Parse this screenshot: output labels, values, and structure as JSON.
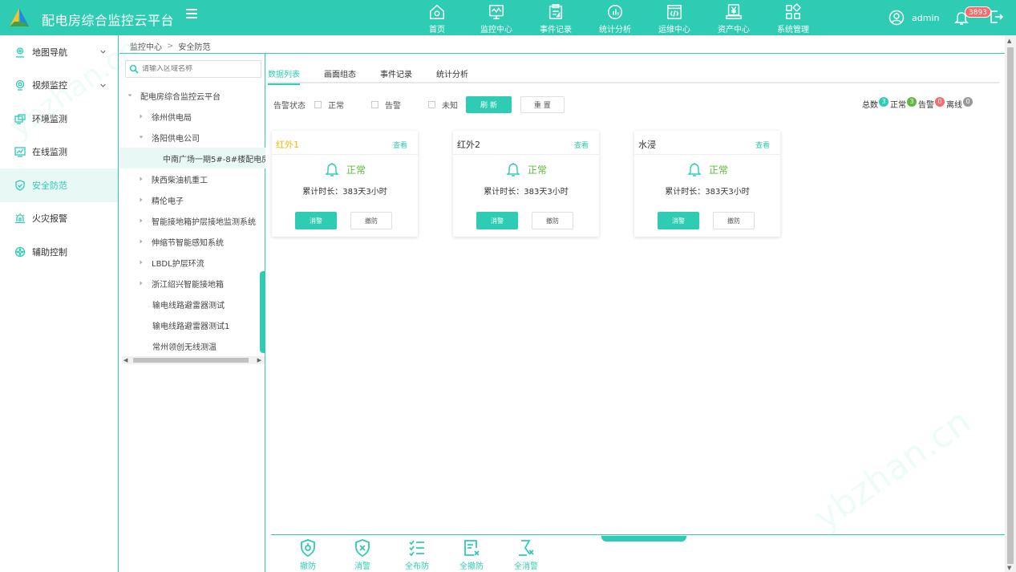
{
  "header": {
    "title": "配电房综合监控云平台",
    "nav": [
      {
        "label": "首页",
        "icon": "home-icon"
      },
      {
        "label": "监控中心",
        "icon": "monitor-icon"
      },
      {
        "label": "事件记录",
        "icon": "clipboard-icon"
      },
      {
        "label": "统计分析",
        "icon": "chart-icon"
      },
      {
        "label": "运维中心",
        "icon": "code-window-icon"
      },
      {
        "label": "资产中心",
        "icon": "asset-icon"
      },
      {
        "label": "系统管理",
        "icon": "grid-icon"
      }
    ],
    "user": "admin",
    "alarm_count": "3893"
  },
  "sidebar": {
    "items": [
      {
        "label": "地图导航",
        "icon": "map-pin-icon",
        "expandable": true
      },
      {
        "label": "视频监控",
        "icon": "camera-icon",
        "expandable": true
      },
      {
        "label": "环境监测",
        "icon": "environment-icon"
      },
      {
        "label": "在线监测",
        "icon": "online-chart-icon"
      },
      {
        "label": "安全防范",
        "icon": "shield-check-icon",
        "active": true
      },
      {
        "label": "火灾报警",
        "icon": "fire-alarm-icon"
      },
      {
        "label": "辅助控制",
        "icon": "control-icon"
      }
    ]
  },
  "breadcrumb": {
    "root": "监控中心",
    "current": "安全防范"
  },
  "tree": {
    "search_placeholder": "请输入区域名称",
    "nodes": [
      {
        "label": "配电房综合监控云平台",
        "level": 0,
        "arrow": "down"
      },
      {
        "label": "徐州供电局",
        "level": 1,
        "arrow": "right"
      },
      {
        "label": "洛阳供电公司",
        "level": 1,
        "arrow": "down"
      },
      {
        "label": "中南广场一期5#-8#楼配电房",
        "level": 2,
        "arrow": "none",
        "selected": true
      },
      {
        "label": "陕西柴油机重工",
        "level": 1,
        "arrow": "right"
      },
      {
        "label": "精伦电子",
        "level": 1,
        "arrow": "right"
      },
      {
        "label": "智能接地箱护层接地监测系统",
        "level": 1,
        "arrow": "right"
      },
      {
        "label": "伸缩节智能感知系统",
        "level": 1,
        "arrow": "right"
      },
      {
        "label": "LBDL护层环流",
        "level": 1,
        "arrow": "right"
      },
      {
        "label": "浙江绍兴智能接地箱",
        "level": 1,
        "arrow": "right"
      },
      {
        "label": "输电线路避雷器测试",
        "level": 1,
        "arrow": "none"
      },
      {
        "label": "输电线路避雷器测试1",
        "level": 1,
        "arrow": "none"
      },
      {
        "label": "常州领创无线测温",
        "level": 1,
        "arrow": "none"
      }
    ]
  },
  "tabs": [
    "数据列表",
    "画面组态",
    "事件记录",
    "统计分析"
  ],
  "filter": {
    "label": "告警状态",
    "options": [
      "正常",
      "告警",
      "未知"
    ],
    "refresh": "刷 新",
    "reset": "重 置"
  },
  "stats": {
    "total_label": "总数",
    "total": "3",
    "normal_label": "正常",
    "normal": "3",
    "alarm_label": "告警",
    "alarm": "0",
    "offline_label": "离线",
    "offline": "0",
    "colors": {
      "total": "#2ecdb3",
      "normal": "#5fb83f",
      "alarm": "#f56c6c",
      "offline": "#999999"
    }
  },
  "cards": [
    {
      "title": "红外1",
      "view": "查看",
      "status": "正常",
      "duration": "累计时长：383天3小时",
      "btn_primary": "消警",
      "btn_secondary": "撤防"
    },
    {
      "title": "红外2",
      "view": "查看",
      "status": "正常",
      "duration": "累计时长：383天3小时",
      "btn_primary": "消警",
      "btn_secondary": "撤防"
    },
    {
      "title": "水浸",
      "view": "查看",
      "status": "正常",
      "duration": "累计时长：383天3小时",
      "btn_primary": "消警",
      "btn_secondary": "撤防"
    }
  ],
  "bottom_actions": [
    {
      "label": "撤防",
      "icon": "shield-disarm-icon"
    },
    {
      "label": "消警",
      "icon": "shield-clear-icon"
    },
    {
      "label": "全布防",
      "icon": "list-check-icon"
    },
    {
      "label": "全撤防",
      "icon": "document-x-icon"
    },
    {
      "label": "全消警",
      "icon": "person-x-icon"
    }
  ],
  "colors": {
    "accent": "#2ecdb3",
    "normal": "#5fb83f",
    "highlight": "#f5b800"
  }
}
